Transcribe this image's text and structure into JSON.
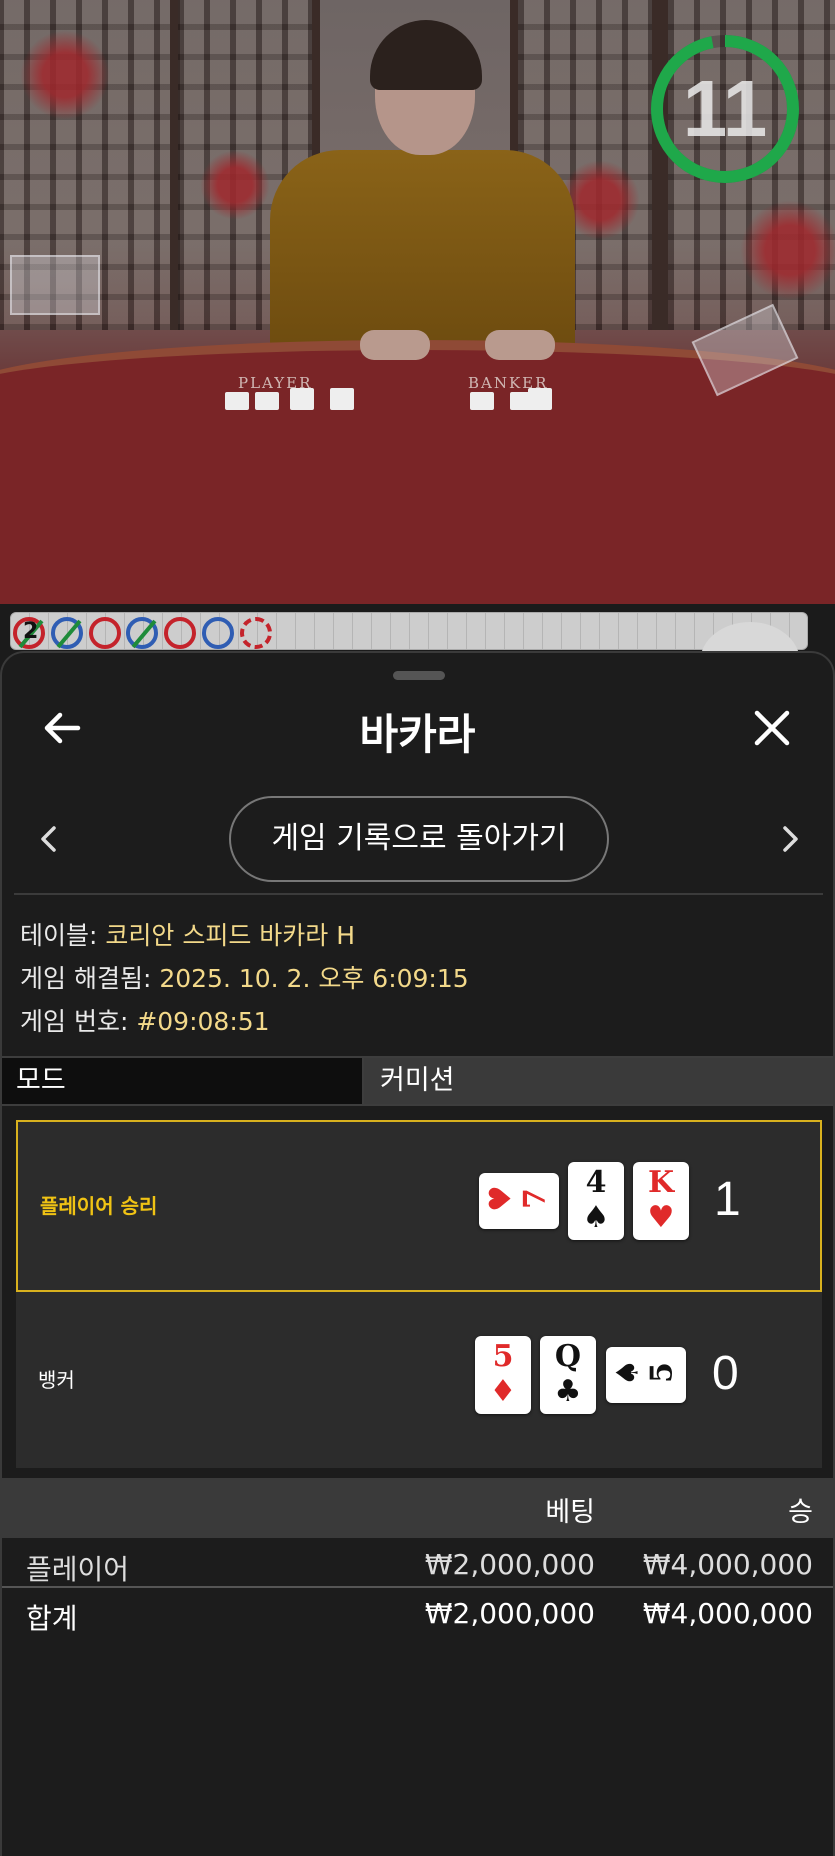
{
  "video": {
    "timer": "11",
    "timer_progress": 0.97,
    "felt_player_label": "PLAYER",
    "felt_banker_label": "BANKER"
  },
  "roadmap": {
    "count": "2",
    "dots": [
      "red-slash",
      "blue-slash",
      "red",
      "blue-slash",
      "red",
      "blue",
      "red-partial"
    ]
  },
  "sheet": {
    "back_icon": "arrow-left-icon",
    "title": "바카라",
    "close_icon": "close-icon",
    "history_button": "게임 기록으로 돌아가기"
  },
  "info": {
    "table_label": "테이블: ",
    "table_value": "코리안 스피드 바카라 H",
    "resolved_label": "게임 해결됨: ",
    "resolved_value": "2025. 10. 2. 오후 6:09:15",
    "number_label": "게임 번호: ",
    "number_value": "#09:08:51"
  },
  "tabs": {
    "mode": "모드",
    "commission": "커미션"
  },
  "results": {
    "player": {
      "label": "플레이어 승리",
      "score": "1",
      "cards": [
        {
          "rank": "7",
          "suit": "♥",
          "color": "red",
          "orientation": "side"
        },
        {
          "rank": "4",
          "suit": "♠",
          "color": "black",
          "orientation": "up"
        },
        {
          "rank": "K",
          "suit": "♥",
          "color": "red",
          "orientation": "up"
        }
      ]
    },
    "banker": {
      "label": "뱅커",
      "score": "0",
      "cards": [
        {
          "rank": "5",
          "suit": "♦",
          "color": "red",
          "orientation": "up"
        },
        {
          "rank": "Q",
          "suit": "♣",
          "color": "black",
          "orientation": "up"
        },
        {
          "rank": "5",
          "suit": "♠",
          "color": "black",
          "orientation": "side"
        }
      ]
    }
  },
  "bets": {
    "headers": [
      "",
      "베팅",
      "승"
    ],
    "rows": [
      {
        "name": "플레이어",
        "bet": "₩2,000,000",
        "win": "₩4,000,000"
      }
    ],
    "total": {
      "name": "합계",
      "bet": "₩2,000,000",
      "win": "₩4,000,000"
    }
  },
  "colors": {
    "highlight": "#f0c314",
    "info_value": "#f3d98a",
    "timer_ring": "#1fa84a"
  }
}
